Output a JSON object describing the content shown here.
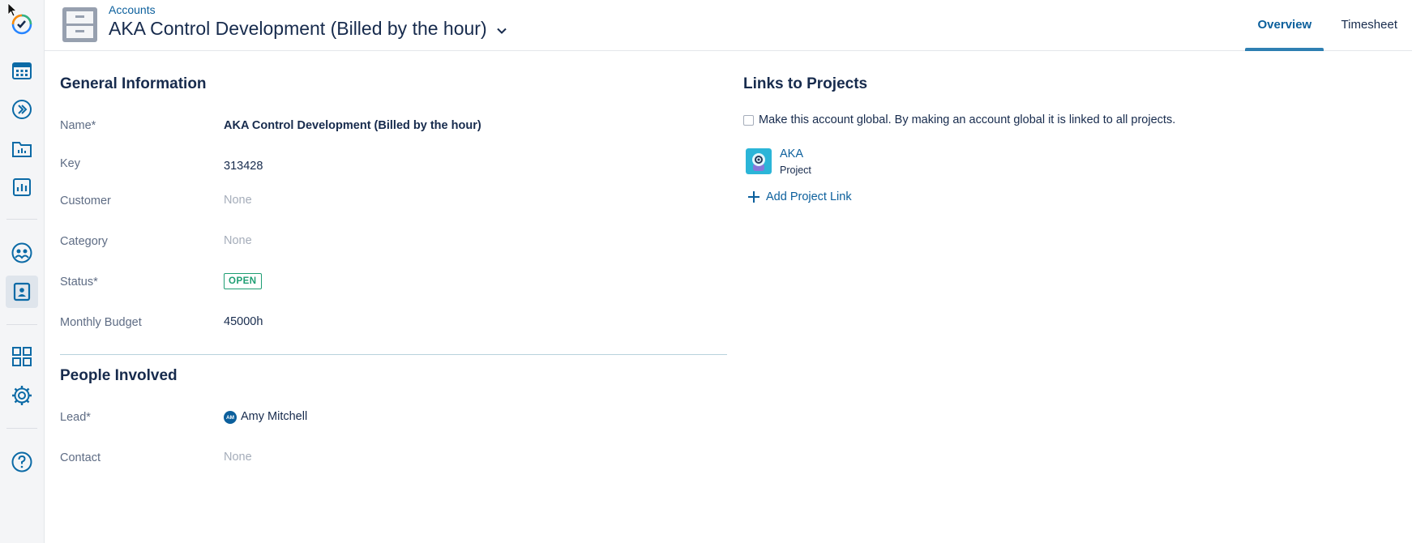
{
  "header": {
    "breadcrumb": "Accounts",
    "title": "AKA Control Development (Billed by the hour)",
    "tabs": [
      {
        "label": "Overview",
        "active": true
      },
      {
        "label": "Timesheet",
        "active": false
      }
    ]
  },
  "sidebar": {
    "items": [
      {
        "icon": "tempo-logo-icon"
      },
      {
        "icon": "calendar-icon"
      },
      {
        "icon": "forward-icon"
      },
      {
        "icon": "folder-chart-icon"
      },
      {
        "icon": "reports-icon"
      },
      {
        "icon": "teams-icon"
      },
      {
        "icon": "accounts-icon",
        "active": true
      },
      {
        "icon": "apps-grid-icon"
      },
      {
        "icon": "settings-gear-icon"
      },
      {
        "icon": "help-icon"
      }
    ]
  },
  "general": {
    "title": "General Information",
    "name_label": "Name*",
    "name_value": "AKA Control Development (Billed by the hour)",
    "key_label": "Key",
    "key_value": "313428",
    "customer_label": "Customer",
    "customer_value": "None",
    "category_label": "Category",
    "category_value": "None",
    "status_label": "Status*",
    "status_value": "OPEN",
    "budget_label": "Monthly Budget",
    "budget_value": "45000h"
  },
  "people": {
    "title": "People Involved",
    "lead_label": "Lead*",
    "lead_initials": "AM",
    "lead_name": "Amy Mitchell",
    "contact_label": "Contact",
    "contact_value": "None"
  },
  "links": {
    "title": "Links to Projects",
    "global_text": "Make this account global. By making an account global it is linked to all projects.",
    "global_checked": false,
    "project_key": "AKA",
    "project_type": "Project",
    "add_link_label": "Add Project Link"
  },
  "colors": {
    "accent": "#0b5f9c",
    "status_open": "#1e9e73",
    "sidebar_icon": "#0b6aa6"
  }
}
